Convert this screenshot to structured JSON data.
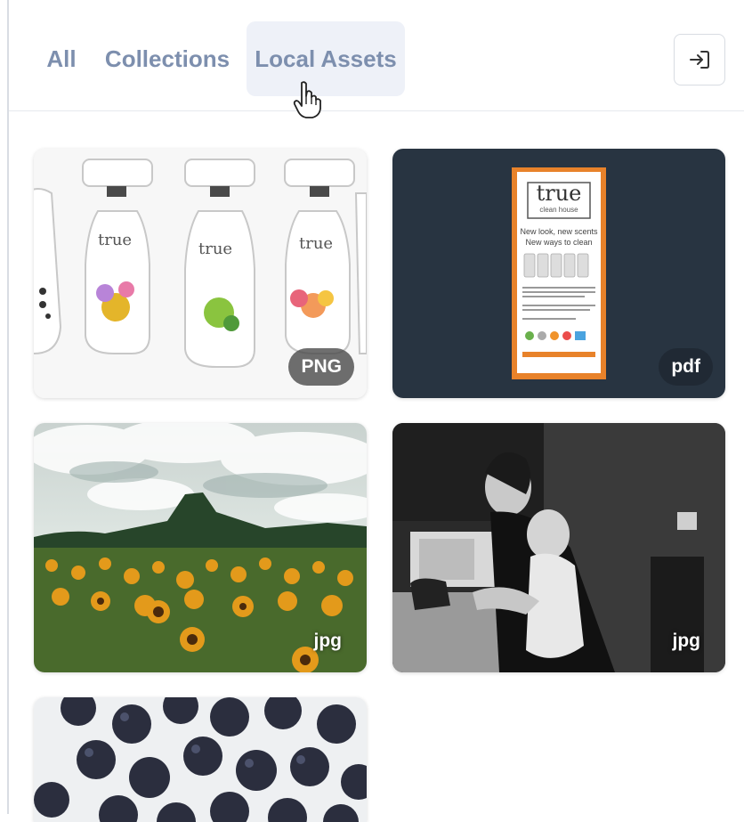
{
  "tabs": [
    {
      "label": "All",
      "active": false
    },
    {
      "label": "Collections",
      "active": false
    },
    {
      "label": "Local Assets",
      "active": true
    }
  ],
  "collapse_icon": "sign-in-arrow-icon",
  "assets": [
    {
      "name": "spray-bottles",
      "type": "PNG"
    },
    {
      "name": "true-clean-house-flyer",
      "type": "pdf",
      "flyer": {
        "brand": "true",
        "sub": "clean house",
        "line1": "New look, new scents",
        "line2": "New ways to clean"
      }
    },
    {
      "name": "sunflower-field",
      "type": "jpg"
    },
    {
      "name": "mother-child-sink",
      "type": "jpg"
    },
    {
      "name": "blueberries",
      "type": ""
    }
  ],
  "colors": {
    "tab_text": "#7d8fae",
    "active_tab_bg": "#eef1f8",
    "pdf_bg": "#283441",
    "flyer_orange": "#e8822a"
  }
}
